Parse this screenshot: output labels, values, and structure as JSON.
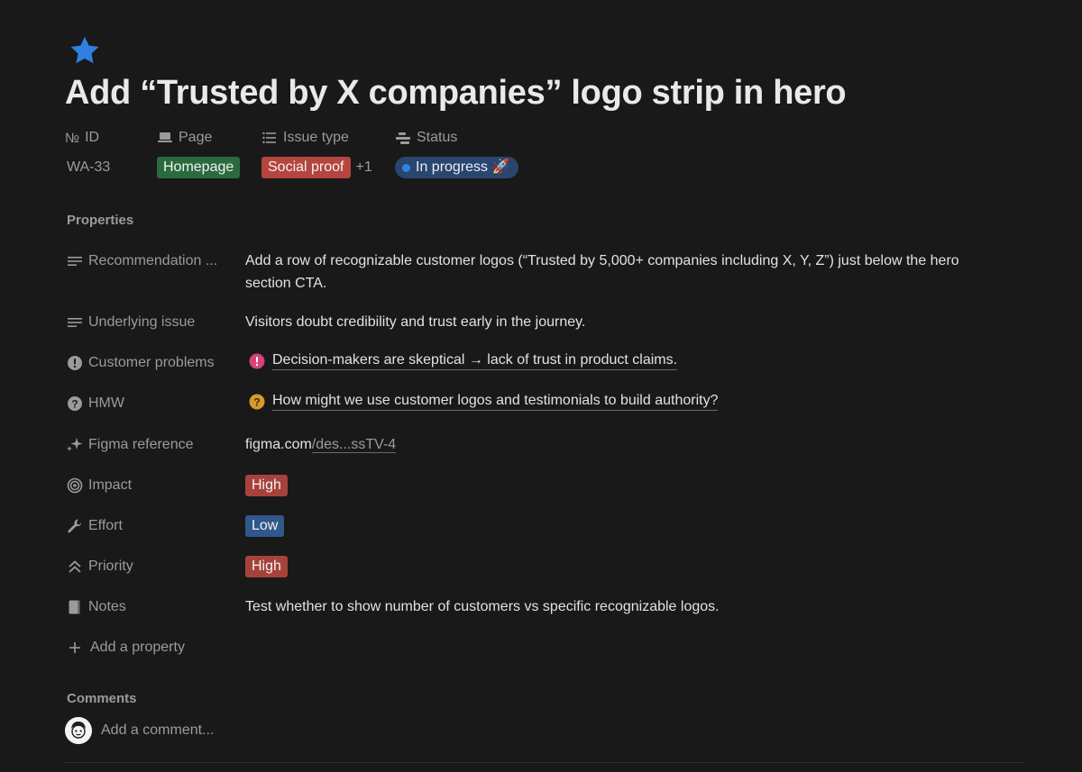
{
  "page": {
    "icon": "star-icon",
    "title": "Add “Trusted by X companies” logo strip in hero"
  },
  "header_props": [
    {
      "label": "ID",
      "icon": "number-icon",
      "icon_text": "№"
    },
    {
      "label": "Page",
      "icon": "laptop-icon"
    },
    {
      "label": "Issue type",
      "icon": "list-icon"
    },
    {
      "label": "Status",
      "icon": "status-icon"
    }
  ],
  "header_values": {
    "id": "WA-33",
    "page": {
      "label": "Homepage",
      "color": "#2b6a3f"
    },
    "issue_type": {
      "label": "Social proof",
      "color": "#b5453f",
      "more": "+1"
    },
    "status": {
      "label": "In progress 🚀",
      "color": "#29466e",
      "dot_color": "#2f84e0"
    }
  },
  "properties_heading": "Properties",
  "properties": {
    "recommendation": {
      "label": "Recommendation ...",
      "icon": "text-lines-icon",
      "value": "Add a row of recognizable customer logos (“Trusted by 5,000+ companies including X, Y, Z”) just below the hero section CTA."
    },
    "underlying_issue": {
      "label": "Underlying issue",
      "icon": "text-lines-icon",
      "value": "Visitors doubt credibility and trust early in the journey."
    },
    "customer_problems": {
      "label": "Customer problems",
      "icon": "exclamation-circle-icon",
      "value": "Decision-makers are skeptical → lack of trust in product claims.",
      "value_icon_color": "#d6427a"
    },
    "hmw": {
      "label": "HMW",
      "icon": "question-circle-icon",
      "value": "How might we use customer logos and testimonials to build authority?",
      "value_icon_color": "#d89a2a"
    },
    "figma": {
      "label": "Figma reference",
      "icon": "sparkles-icon",
      "link_domain": "figma.com",
      "link_rest": "/des...ssTV-4"
    },
    "impact": {
      "label": "Impact",
      "icon": "target-icon",
      "value": "High",
      "color": "#a6423b"
    },
    "effort": {
      "label": "Effort",
      "icon": "wrench-icon",
      "value": "Low",
      "color": "#30588a"
    },
    "priority": {
      "label": "Priority",
      "icon": "double-chevron-up-icon",
      "value": "High",
      "color": "#a6423b"
    },
    "notes": {
      "label": "Notes",
      "icon": "notes-icon",
      "value": "Test whether to show number of customers vs specific recognizable logos."
    },
    "add_property": {
      "label": "Add a property",
      "icon": "plus-icon"
    }
  },
  "comments": {
    "heading": "Comments",
    "placeholder": "Add a comment...",
    "avatar": "avatar"
  }
}
